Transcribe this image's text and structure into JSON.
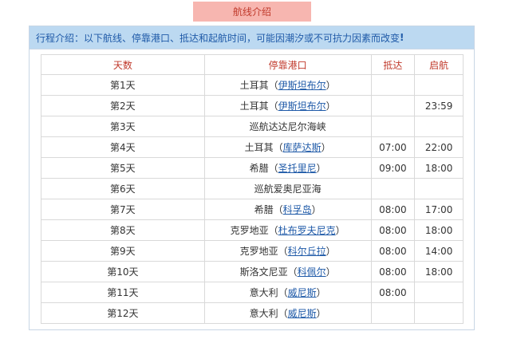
{
  "tab": {
    "label": "航线介绍"
  },
  "notice": {
    "text": "行程介绍：以下航线、停靠港口、抵达和起航时间，可能因潮汐或不可抗力因素而改变",
    "bang": "!"
  },
  "table": {
    "headers": {
      "day": "天数",
      "port": "停靠港口",
      "arrive": "抵达",
      "depart": "启航"
    },
    "rows": [
      {
        "day": "第1天",
        "country": "土耳其",
        "port": "伊斯坦布尔",
        "arrive": "",
        "depart": ""
      },
      {
        "day": "第2天",
        "country": "土耳其",
        "port": "伊斯坦布尔",
        "arrive": "",
        "depart": "23:59"
      },
      {
        "day": "第3天",
        "country": "巡航达达尼尔海峡",
        "port": "",
        "arrive": "",
        "depart": ""
      },
      {
        "day": "第4天",
        "country": "土耳其",
        "port": "库萨达斯",
        "arrive": "07:00",
        "depart": "22:00"
      },
      {
        "day": "第5天",
        "country": "希腊",
        "port": "圣托里尼",
        "arrive": "09:00",
        "depart": "18:00"
      },
      {
        "day": "第6天",
        "country": "巡航爱奥尼亚海",
        "port": "",
        "arrive": "",
        "depart": ""
      },
      {
        "day": "第7天",
        "country": "希腊",
        "port": "科孚岛",
        "arrive": "08:00",
        "depart": "17:00"
      },
      {
        "day": "第8天",
        "country": "克罗地亚",
        "port": "杜布罗夫尼克",
        "arrive": "08:00",
        "depart": "18:00"
      },
      {
        "day": "第9天",
        "country": "克罗地亚",
        "port": "科尔丘拉",
        "arrive": "08:00",
        "depart": "14:00"
      },
      {
        "day": "第10天",
        "country": "斯洛文尼亚",
        "port": "科佩尔",
        "arrive": "08:00",
        "depart": "18:00"
      },
      {
        "day": "第11天",
        "country": "意大利",
        "port": "威尼斯",
        "arrive": "08:00",
        "depart": ""
      },
      {
        "day": "第12天",
        "country": "意大利",
        "port": "威尼斯",
        "arrive": "",
        "depart": ""
      }
    ]
  },
  "colors": {
    "tab_bg": "#f7b6b0",
    "header_text": "#c0392b",
    "notice_bg": "#bcd9f1",
    "link": "#1f5aa8"
  }
}
